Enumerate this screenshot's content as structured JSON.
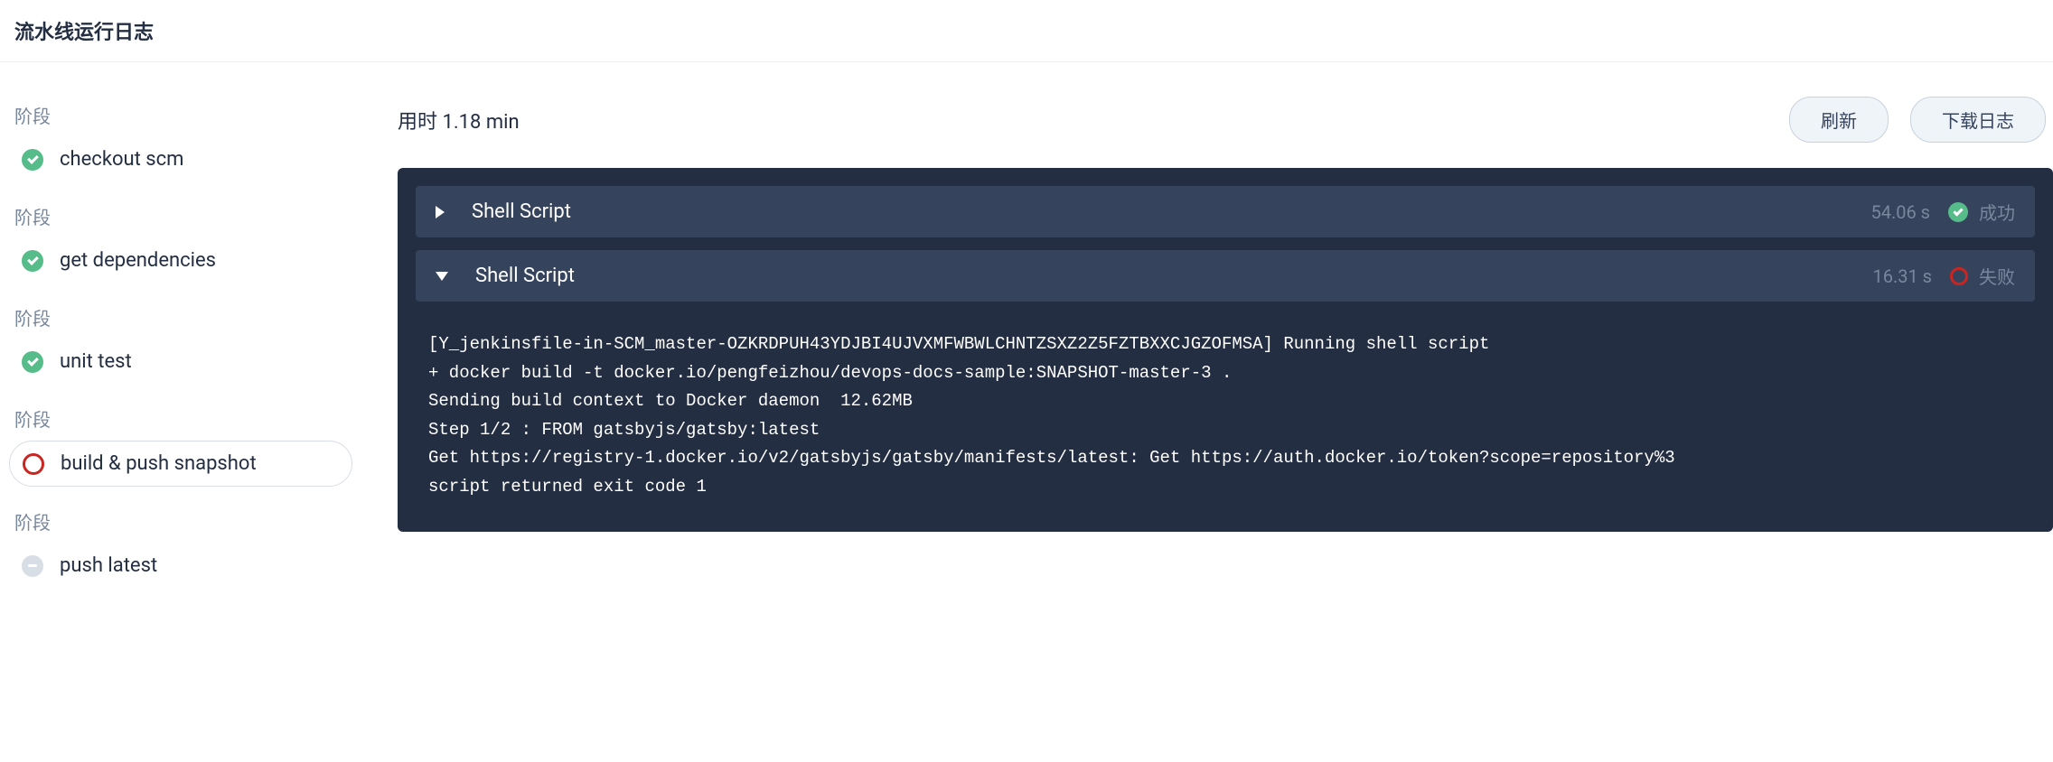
{
  "header": {
    "title": "流水线运行日志"
  },
  "sidebar": {
    "stage_label": "阶段",
    "stages": [
      {
        "name": "checkout scm",
        "status": "success"
      },
      {
        "name": "get dependencies",
        "status": "success"
      },
      {
        "name": "unit test",
        "status": "success"
      },
      {
        "name": "build & push snapshot",
        "status": "fail"
      },
      {
        "name": "push latest",
        "status": "pending"
      }
    ]
  },
  "main": {
    "duration_prefix": "用时 ",
    "duration_value": "1.18 min",
    "actions": {
      "refresh": "刷新",
      "download": "下载日志"
    },
    "steps": [
      {
        "name": "Shell Script",
        "time": "54.06 s",
        "status": "success",
        "status_label": "成功",
        "expanded": false
      },
      {
        "name": "Shell Script",
        "time": "16.31 s",
        "status": "fail",
        "status_label": "失败",
        "expanded": true
      }
    ],
    "log_lines": [
      "[Y_jenkinsfile-in-SCM_master-OZKRDPUH43YDJBI4UJVXMFWBWLCHNTZSXZ2Z5FZTBXXCJGZOFMSA] Running shell script",
      "+ docker build -t docker.io/pengfeizhou/devops-docs-sample:SNAPSHOT-master-3 .",
      "Sending build context to Docker daemon  12.62MB",
      "Step 1/2 : FROM gatsbyjs/gatsby:latest",
      "Get https://registry-1.docker.io/v2/gatsbyjs/gatsby/manifests/latest: Get https://auth.docker.io/token?scope=repository%3",
      "script returned exit code 1"
    ]
  }
}
